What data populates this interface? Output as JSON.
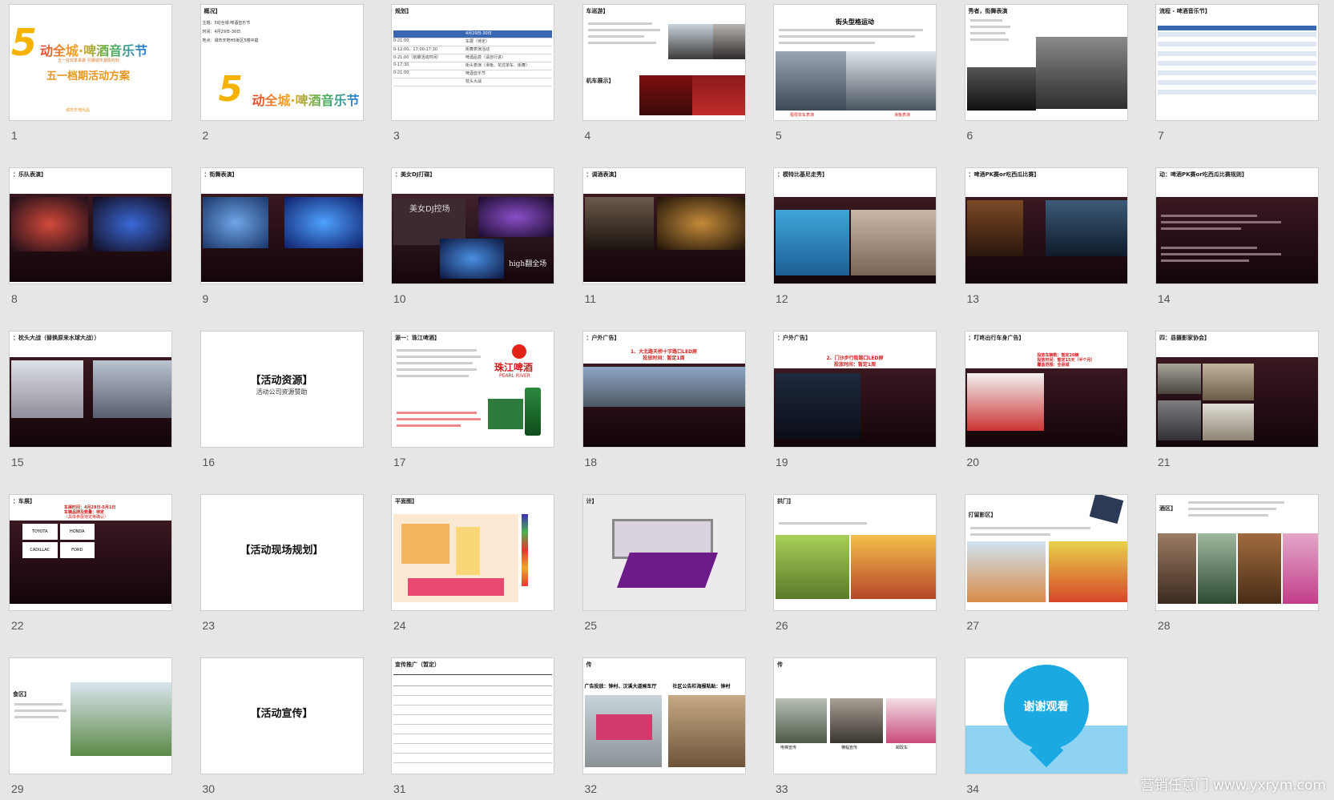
{
  "slides": [
    {
      "num": "1",
      "title": "动全城·啤酒音乐节",
      "subtitle": "五一档期活动方案",
      "tagline": "五一狂欢季来袭 引爆城市激情时刻",
      "footer": "城市天地出品"
    },
    {
      "num": "2",
      "header": "概况】",
      "lines": [
        "主题：5动全城·啤酒音乐节",
        "时间：4月29日-30日",
        "地点：城市天地H5街区5楼中庭"
      ],
      "title": "动全城·啤酒音乐节"
    },
    {
      "num": "3",
      "header": "规划】",
      "table_head": "4月29日-30日",
      "table_rows": [
        "0-21:00",
        "0-12:00、17:00-17:30",
        "0-21:00（前期活动时间）",
        "0-17:30",
        "0-21:00"
      ],
      "table_right": [
        "车展（待定）",
        "街舞表演活动",
        "啤酒品尝（请自行进）",
        "街头表演（滑板、花式单车、街舞）",
        "啤酒音乐节",
        "枕头大战"
      ]
    },
    {
      "num": "4",
      "header": "车巡游】",
      "subheader": "机车展示】"
    },
    {
      "num": "5",
      "title": "街头型格运动",
      "caption_left": "极限单车表演",
      "caption_right": "滑板表演"
    },
    {
      "num": "6",
      "header": "秀者，街舞表演"
    },
    {
      "num": "7",
      "header": "流程 - 啤酒音乐节】"
    },
    {
      "num": "8",
      "header": "：乐队表演】"
    },
    {
      "num": "9",
      "header": "：街舞表演】"
    },
    {
      "num": "10",
      "header": "：美女DJ打碟】",
      "overlay": "美女DJ控场",
      "overlay2": "high翻全场"
    },
    {
      "num": "11",
      "header": "：调酒表演】"
    },
    {
      "num": "12",
      "header": "：模特比基尼走秀】"
    },
    {
      "num": "13",
      "header": "：啤酒PK赛or吃西瓜比赛】"
    },
    {
      "num": "14",
      "header": "动：啤酒PK赛or吃西瓜比赛规则】"
    },
    {
      "num": "15",
      "header": "：枕头大战（替换原来水球大战））"
    },
    {
      "num": "16",
      "title": "【活动资源】",
      "subtitle": "活动公司资源赞助"
    },
    {
      "num": "17",
      "header": "源一：珠江啤酒】",
      "brand": "珠江啤酒",
      "brand_en": "PEARL RIVER"
    },
    {
      "num": "18",
      "header": "：户外广告】",
      "red": "1、大北路天桥十字路口LED屏",
      "red2": "投放时间：暂定1周"
    },
    {
      "num": "19",
      "header": "：户外广告】",
      "red": "2、门沙步行街路口LED屏",
      "red2": "投放时间：暂定1周"
    },
    {
      "num": "20",
      "header": "：叮咚出行车身广告】",
      "red": "投放车辆数：暂定20辆",
      "red2": "投放时间：暂定15天（半个月）",
      "red3": "覆盖范围：全县城"
    },
    {
      "num": "21",
      "header": "四：县摄影家协会】"
    },
    {
      "num": "22",
      "header": "：车展】",
      "red": "车展时间：4月29日-5月1日",
      "red2": "车辆品牌及数量：待定",
      "red3": "（具体参展待定等确认）",
      "logos": [
        "TOYOTA",
        "HONDA",
        "CADILLAC",
        "FORD"
      ]
    },
    {
      "num": "23",
      "title": "【活动现场规划】"
    },
    {
      "num": "24",
      "header": "平面图】"
    },
    {
      "num": "25",
      "header": "计】"
    },
    {
      "num": "26",
      "header": "拱门】"
    },
    {
      "num": "27",
      "header": "打留影区】"
    },
    {
      "num": "28",
      "header": "酒区】"
    },
    {
      "num": "29",
      "header": "食区】"
    },
    {
      "num": "30",
      "title": "【活动宣传】"
    },
    {
      "num": "31",
      "header": "宣传推广（暂定）"
    },
    {
      "num": "32",
      "header": "传",
      "left": "广告投放：钟村、汉溪大道候车厅",
      "right": "社区公告栏海报粘贴：钟村"
    },
    {
      "num": "33",
      "header": "传",
      "c1": "电梯宣传",
      "c2": "横幅宣传",
      "c3": "邮政车"
    },
    {
      "num": "34",
      "thanks": "谢谢观看"
    }
  ],
  "watermark": "营销任意门 www.yxrym.com",
  "colors": {
    "background": "#e6e6e6",
    "table_blue": "#3a67b1",
    "accent_red": "#d21f1f",
    "thanks_blue": "#1ba9e1"
  }
}
